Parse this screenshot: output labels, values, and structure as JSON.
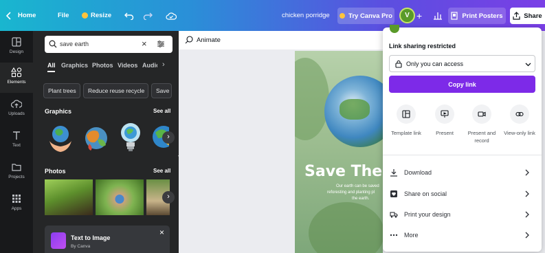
{
  "topbar": {
    "home_label": "Home",
    "file_label": "File",
    "resize_label": "Resize",
    "design_title": "chicken porridge",
    "try_canva_label": "Try Canva Pro",
    "avatar_initial": "V",
    "print_label": "Print Posters",
    "share_label": "Share"
  },
  "rail": {
    "items": [
      {
        "label": "Design",
        "icon": "layout-icon"
      },
      {
        "label": "Elements",
        "icon": "shapes-icon"
      },
      {
        "label": "Uploads",
        "icon": "upload-cloud-icon"
      },
      {
        "label": "Text",
        "icon": "text-icon"
      },
      {
        "label": "Projects",
        "icon": "folder-icon"
      },
      {
        "label": "Apps",
        "icon": "apps-grid-icon"
      }
    ]
  },
  "panel": {
    "search_value": "save earth",
    "tabs": [
      "All",
      "Graphics",
      "Photos",
      "Videos",
      "Audio"
    ],
    "chips": [
      "Plant trees",
      "Reduce reuse recycle",
      "Save"
    ],
    "graphics_heading": "Graphics",
    "photos_heading": "Photos",
    "see_all": "See all",
    "promo_title": "Text to Image",
    "promo_sub": "By Canva"
  },
  "canvas": {
    "animate_label": "Animate",
    "poster_title": "Save The E",
    "poster_body_1": "Our earth can be saved",
    "poster_body_2": "reforesting and planting pl",
    "poster_body_3": "the earth."
  },
  "share": {
    "section_label": "Link sharing restricted",
    "access_value": "Only you can access",
    "copy_link_label": "Copy link",
    "actions": [
      {
        "label_1": "Template link",
        "label_2": ""
      },
      {
        "label_1": "Present",
        "label_2": ""
      },
      {
        "label_1": "Present and",
        "label_2": "record"
      },
      {
        "label_1": "View-only link",
        "label_2": ""
      }
    ],
    "rows": [
      "Download",
      "Share on social",
      "Print your design",
      "More"
    ]
  },
  "colors": {
    "accent_purple": "#7d2ae8",
    "panel_bg": "#252627",
    "rail_bg": "#18191b"
  }
}
